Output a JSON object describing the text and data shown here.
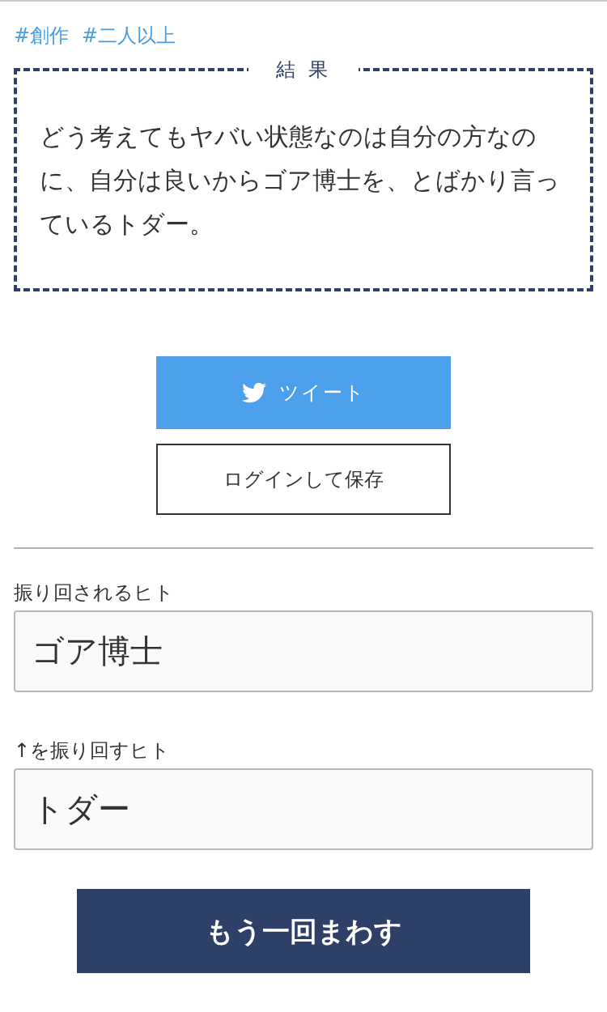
{
  "tags": [
    "#創作",
    "#二人以上"
  ],
  "result": {
    "title": "結 果",
    "text": "どう考えてもヤバい状態なのは自分の方なのに、自分は良いからゴア博士を、とばかり言っているトダー。"
  },
  "buttons": {
    "tweet": "ツイート",
    "save": "ログインして保存"
  },
  "fields": [
    {
      "label": "振り回されるヒト",
      "value": "ゴア博士"
    },
    {
      "label": "↑を振り回すヒト",
      "value": "トダー"
    }
  ],
  "spin_button": "もう一回まわす"
}
